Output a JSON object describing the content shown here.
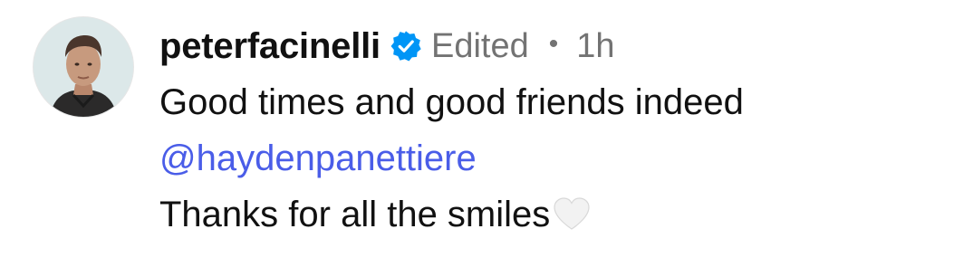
{
  "comment": {
    "username": "peterfacinelli",
    "verified_icon": "verified-badge-icon",
    "edited_label": "Edited",
    "separator": "•",
    "timestamp": "1h",
    "lines": {
      "line1": "Good times and good friends indeed",
      "mention": "@haydenpanettiere",
      "line3": "Thanks for all the smiles"
    },
    "heart_icon": "white-heart-icon",
    "colors": {
      "text": "#111111",
      "muted": "#737373",
      "mention": "#4a5de8",
      "verified": "#0095f6"
    }
  }
}
